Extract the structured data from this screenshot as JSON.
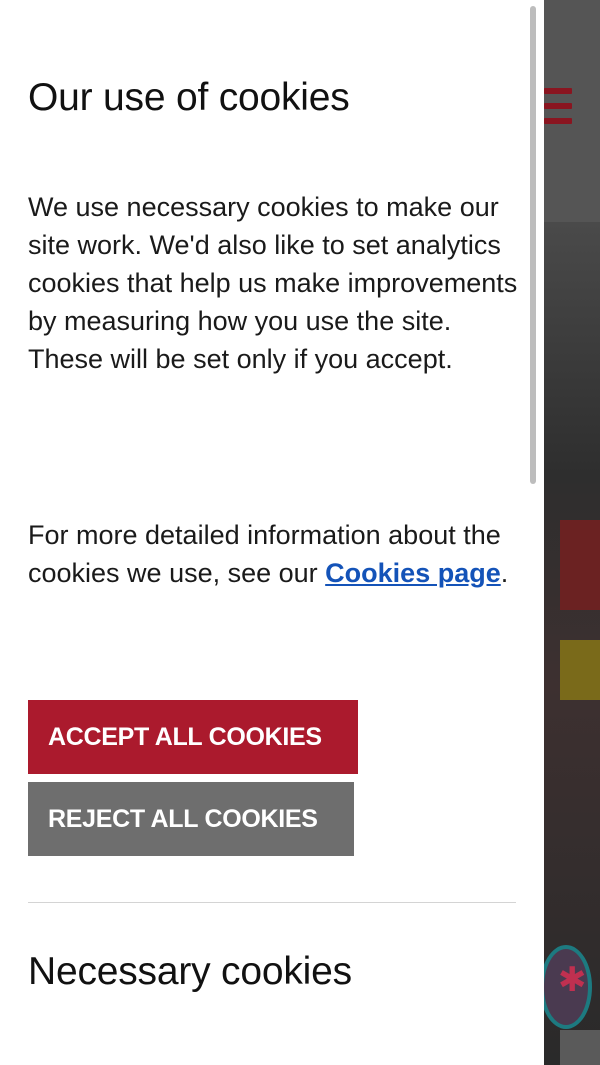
{
  "panel": {
    "title": "Our use of cookies",
    "intro": "We use necessary cookies to make our site work. We'd also like to set analytics cookies that help us make improvements by measuring how you use the site. These will be set only if you accept.",
    "more_info_prefix": "For more detailed information about the cookies we use, see our ",
    "cookies_link_label": "Cookies page",
    "more_info_suffix": ".",
    "accept_label": "ACCEPT ALL COOKIES",
    "reject_label": "REJECT ALL COOKIES",
    "necessary_heading": "Necessary cookies"
  },
  "background": {
    "menu_icon": "hamburger-menu-icon",
    "badge_icon": "circular-badge-icon"
  },
  "colors": {
    "accept_button": "#ab1a2d",
    "reject_button": "#6e6e6e",
    "link": "#1453b8",
    "menu_icon": "#8a1520"
  }
}
